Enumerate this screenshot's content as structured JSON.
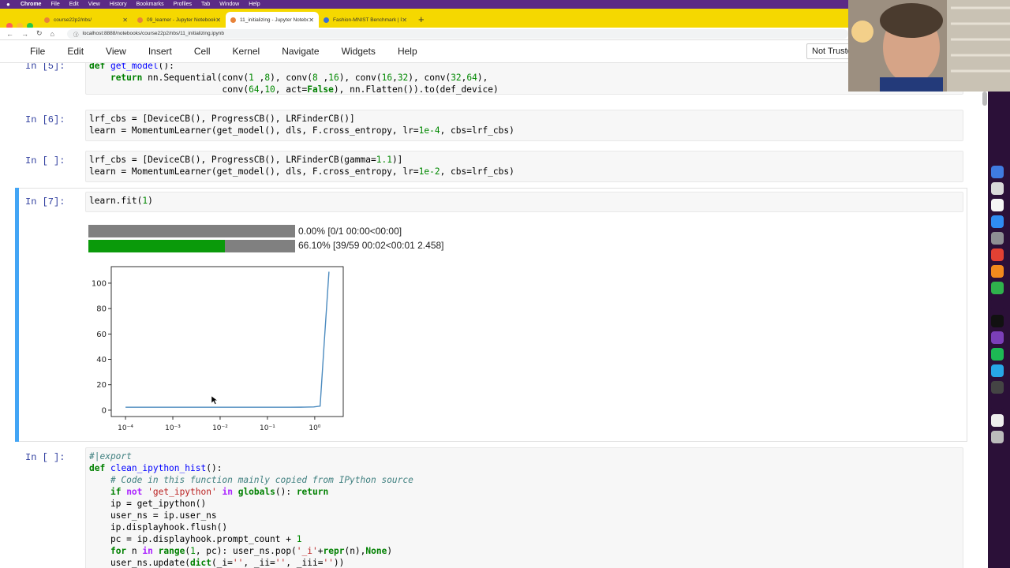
{
  "menubar": {
    "app": "Chrome",
    "items": [
      "File",
      "Edit",
      "View",
      "History",
      "Bookmarks",
      "Profiles",
      "Tab",
      "Window",
      "Help"
    ]
  },
  "tabs": [
    {
      "label": "course22p2/nbs/",
      "active": false
    },
    {
      "label": "09_learner - Jupyter Notebook",
      "active": false
    },
    {
      "label": "11_initializing - Jupyter Notebook",
      "active": true
    },
    {
      "label": "Fashion-MNIST Benchmark | Pap",
      "active": false
    }
  ],
  "address": {
    "url": "localhost:8888/notebooks/course22p2/nbs/11_initializing.ipynb"
  },
  "jupyter_menu": [
    "File",
    "Edit",
    "View",
    "Insert",
    "Cell",
    "Kernel",
    "Navigate",
    "Widgets",
    "Help"
  ],
  "trusted_label": "Not Truste",
  "cells": {
    "c5": {
      "prompt": "In [5]:"
    },
    "c6": {
      "prompt": "In [6]:"
    },
    "cblank": {
      "prompt": "In [ ]:"
    },
    "c7": {
      "prompt": "In [7]:"
    },
    "cexport": {
      "prompt": "In [ ]:"
    }
  },
  "progress": [
    {
      "text": "0.00% [0/1 00:00<00:00]",
      "fraction": 0.0
    },
    {
      "text": "66.10% [39/59 00:02<00:01 2.458]",
      "fraction": 0.661
    }
  ],
  "chart_data": {
    "type": "line",
    "x_scale": "log",
    "xlim": [
      5e-05,
      4
    ],
    "ylim": [
      -5,
      113
    ],
    "yticks": [
      "0",
      "20",
      "40",
      "60",
      "80",
      "100"
    ],
    "xticks": [
      "10⁻⁴",
      "10⁻³",
      "10⁻²",
      "10⁻¹",
      "10⁰"
    ],
    "series": [
      {
        "x": [
          0.0001,
          0.0003,
          0.001,
          0.003,
          0.01,
          0.03,
          0.1,
          0.3,
          0.6,
          0.95,
          1.3,
          1.6,
          2.0
        ],
        "y": [
          2.3,
          2.3,
          2.3,
          2.3,
          2.3,
          2.3,
          2.3,
          2.3,
          2.4,
          2.6,
          3.2,
          55,
          109
        ],
        "color": "#4c8bbf"
      }
    ]
  }
}
